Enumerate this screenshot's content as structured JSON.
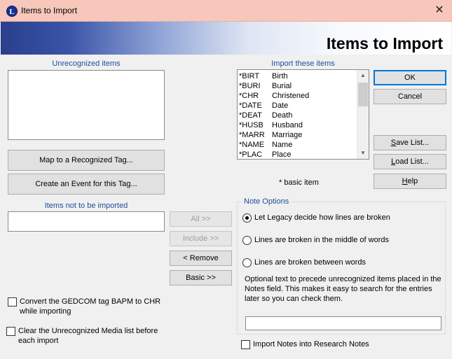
{
  "window": {
    "title": "Items to Import",
    "app_icon_letter": "L"
  },
  "banner": {
    "title": "Items to Import"
  },
  "unrecognized": {
    "label": "Unrecognized items"
  },
  "import_list": {
    "label": "Import these items",
    "rows": [
      {
        "tag": "*BIRT",
        "desc": "Birth"
      },
      {
        "tag": "*BURI",
        "desc": "Burial"
      },
      {
        "tag": "*CHR",
        "desc": "Christened"
      },
      {
        "tag": "*DATE",
        "desc": "Date"
      },
      {
        "tag": "*DEAT",
        "desc": "Death"
      },
      {
        "tag": "*HUSB",
        "desc": "Husband"
      },
      {
        "tag": "*MARR",
        "desc": "Marriage"
      },
      {
        "tag": "*NAME",
        "desc": "Name"
      },
      {
        "tag": "*PLAC",
        "desc": "Place"
      }
    ],
    "footnote": "* basic item"
  },
  "buttons": {
    "ok": "OK",
    "cancel": "Cancel",
    "save_list_u": "S",
    "save_list_rest": "ave List...",
    "load_list_u": "L",
    "load_list_rest": "oad List...",
    "help_u": "H",
    "help_rest": "elp",
    "map_tag": "Map to a Recognized Tag...",
    "create_event": "Create an Event for this Tag...",
    "all": "All  >>",
    "include": "Include  >>",
    "remove": "<  Remove",
    "basic": "Basic >>"
  },
  "not_imported": {
    "label": "Items not to be imported"
  },
  "note_options": {
    "title": "Note Options",
    "radio1": "Let Legacy decide how lines are broken",
    "radio2": "Lines are broken in the middle of words",
    "radio3": "Lines are broken between words",
    "selected": 1,
    "description": "Optional text to precede unrecognized items placed in the Notes field.  This makes it easy to search for the entries later so you can check them.",
    "prefix_value": ""
  },
  "checkboxes": {
    "convert_bapm": "Convert the GEDCOM tag BAPM to CHR while importing",
    "clear_media": "Clear the Unrecognized Media list before each import",
    "import_notes": "Import Notes into Research Notes"
  },
  "colors": {
    "accent_label": "#1d4d99",
    "titlebar": "#f7c7bb",
    "banner_dark": "#2a3f8c"
  },
  "icons": {
    "close": "close-icon",
    "app": "legacy-logo-icon"
  }
}
